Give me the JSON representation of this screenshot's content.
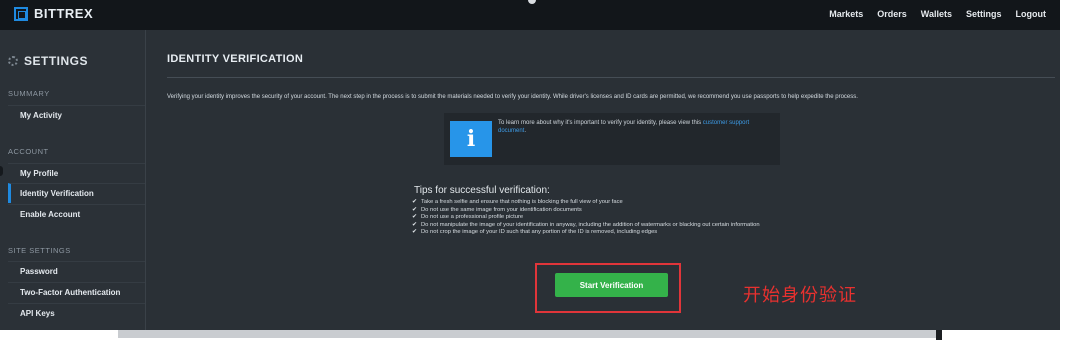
{
  "brand": {
    "name": "BITTREX"
  },
  "topnav": [
    "Markets",
    "Orders",
    "Wallets",
    "Settings",
    "Logout"
  ],
  "sidebar": {
    "title": "SETTINGS",
    "sections": [
      {
        "label": "SUMMARY",
        "items": [
          "My Activity"
        ]
      },
      {
        "label": "ACCOUNT",
        "items": [
          "My Profile",
          "Identity Verification",
          "Enable Account"
        ]
      },
      {
        "label": "SITE SETTINGS",
        "items": [
          "Password",
          "Two-Factor Authentication",
          "API Keys"
        ]
      }
    ],
    "active_item": "Identity Verification"
  },
  "main": {
    "title": "IDENTITY VERIFICATION",
    "intro": "Verifying your identity improves the security of your account. The next step in the process is to submit the materials needed to verify your identity. While driver's licenses and ID cards are permitted, we recommend you use passports to help expedite the process.",
    "info": {
      "text": "To learn more about why it's important to verify your identity, please view this",
      "link": "customer support document",
      "suffix": "."
    },
    "tips_title": "Tips for successful verification:",
    "tips": [
      "Take a fresh selfie and ensure that nothing is blocking the full view of your face",
      "Do not use the same image from your identification documents",
      "Do not use a professional profile picture",
      "Do not manipulate the image of your identification in anyway, including the addition of watermarks or blacking out certain information",
      "Do not crop the image of your ID such that any portion of the ID is removed, including edges"
    ],
    "start_button": "Start Verification"
  },
  "annotation": "开始身份验证",
  "colors": {
    "accent": "#1f8ae0",
    "button": "#34b24a",
    "annotation": "#e0353a",
    "background": "#2a3036"
  }
}
